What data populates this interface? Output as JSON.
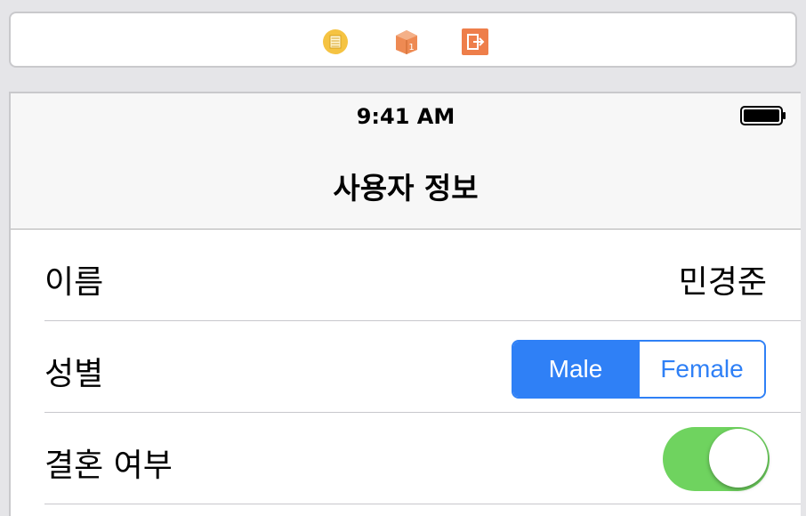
{
  "dock": {
    "icons": [
      "view-controller-icon",
      "first-responder-icon",
      "exit-icon"
    ],
    "colors": {
      "view_controller": "#f5c342",
      "first_responder": "#ee8a53",
      "exit": "#ee7e4a"
    },
    "first_responder_badge": "1"
  },
  "status_bar": {
    "time": "9:41 AM",
    "battery_icon": "battery-icon"
  },
  "navbar": {
    "title": "사용자 정보"
  },
  "rows": [
    {
      "label": "이름",
      "value": "민경준"
    },
    {
      "label": "성별",
      "segments": [
        "Male",
        "Female"
      ],
      "selected": "Male"
    },
    {
      "label": "결혼 여부",
      "switch_on": true
    }
  ],
  "colors": {
    "tint": "#2f80f6",
    "switch_on": "#6fd35f",
    "navbar_bg": "#f7f7f7",
    "canvas_bg": "#e5e5e8"
  }
}
